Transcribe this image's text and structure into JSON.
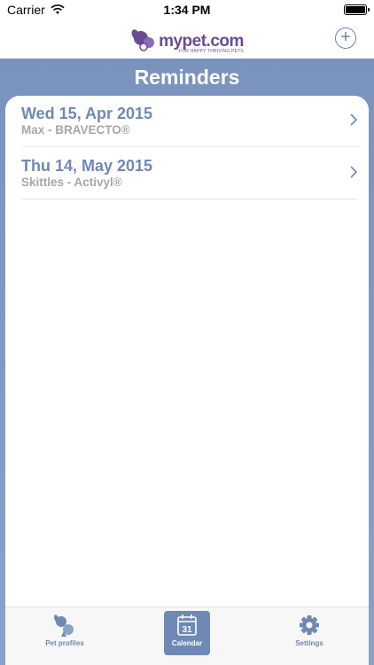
{
  "status_bar": {
    "carrier": "Carrier",
    "time": "1:34 PM"
  },
  "nav": {
    "logo_text": "mypet.com",
    "logo_tagline": "FOR HAPPY THRIVING PETS",
    "add_icon": "plus-circle-icon"
  },
  "page": {
    "title": "Reminders"
  },
  "reminders": [
    {
      "date": "Wed 15, Apr 2015",
      "detail": "Max - BRAVECTO®"
    },
    {
      "date": "Thu 14, May 2015",
      "detail": "Skittles - Activyl®"
    }
  ],
  "tabs": [
    {
      "label": "Pet profiles",
      "icon": "pets-icon",
      "active": false
    },
    {
      "label": "Calendar",
      "icon": "calendar-icon",
      "calendar_day": "31",
      "active": true
    },
    {
      "label": "Settings",
      "icon": "gear-icon",
      "active": false
    }
  ],
  "colors": {
    "accent": "#6f89b4",
    "header_bg": "#7a93bd",
    "logo": "#6a4c93",
    "muted_text": "#a7a7a7"
  }
}
